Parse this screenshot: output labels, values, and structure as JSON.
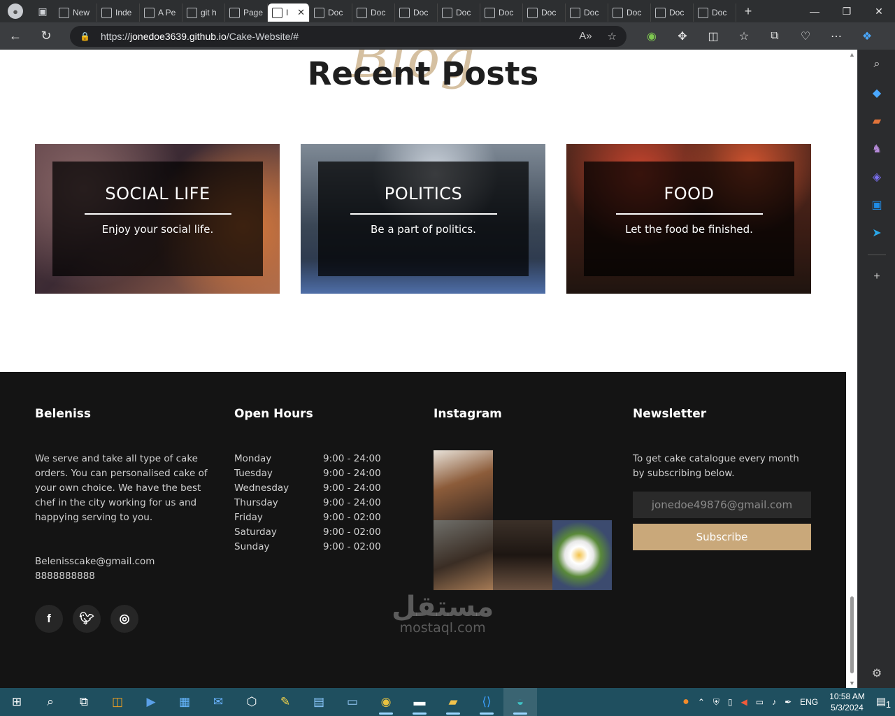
{
  "browser": {
    "tabs": [
      {
        "label": "New"
      },
      {
        "label": "Inde"
      },
      {
        "label": "A Pe"
      },
      {
        "label": "git h"
      },
      {
        "label": "Page"
      },
      {
        "label": "I"
      },
      {
        "label": "Doc"
      },
      {
        "label": "Doc"
      },
      {
        "label": "Doc"
      },
      {
        "label": "Doc"
      },
      {
        "label": "Doc"
      },
      {
        "label": "Doc"
      },
      {
        "label": "Doc"
      },
      {
        "label": "Doc"
      },
      {
        "label": "Doc"
      },
      {
        "label": "Doc"
      }
    ],
    "url_prefix": "https://",
    "url_domain": "jonedoe3639.github.io",
    "url_path": "/Cake-Website/#"
  },
  "blog": {
    "script_word": "Blog",
    "title": "Recent Posts",
    "cards": [
      {
        "title": "SOCIAL LIFE",
        "text": "Enjoy your social life."
      },
      {
        "title": "POLITICS",
        "text": "Be a part of politics."
      },
      {
        "title": "FOOD",
        "text": "Let the food be finished."
      }
    ]
  },
  "footer": {
    "brand": {
      "heading": "Beleniss",
      "about": "We serve and take all type of cake orders. You can personalised cake of your own choice. We have the best chef in the city working for us and happying serving to you.",
      "email": "Belenisscake@gmail.com",
      "phone": "8888888888"
    },
    "hours": {
      "heading": "Open Hours",
      "rows": [
        {
          "day": "Monday",
          "time": "9:00 - 24:00"
        },
        {
          "day": "Tuesday",
          "time": "9:00 - 24:00"
        },
        {
          "day": "Wednesday",
          "time": "9:00 - 24:00"
        },
        {
          "day": "Thursday",
          "time": "9:00 - 24:00"
        },
        {
          "day": "Friday",
          "time": "9:00 - 02:00"
        },
        {
          "day": "Saturday",
          "time": "9:00 - 02:00"
        },
        {
          "day": "Sunday",
          "time": "9:00 - 02:00"
        }
      ]
    },
    "instagram": {
      "heading": "Instagram"
    },
    "newsletter": {
      "heading": "Newsletter",
      "text": "To get cake catalogue every month by subscribing below.",
      "placeholder": "jonedoe49876@gmail.com",
      "button": "Subscribe"
    }
  },
  "watermark": {
    "line1": "مستقل",
    "line2": "mostaql.com"
  },
  "taskbar": {
    "language": "ENG",
    "time": "10:58 AM",
    "date": "5/3/2024",
    "notification_count": "1"
  },
  "colors": {
    "accent_gold": "#c9a87a",
    "footer_bg": "#141414",
    "taskbar_bg": "#1f4f5f"
  }
}
